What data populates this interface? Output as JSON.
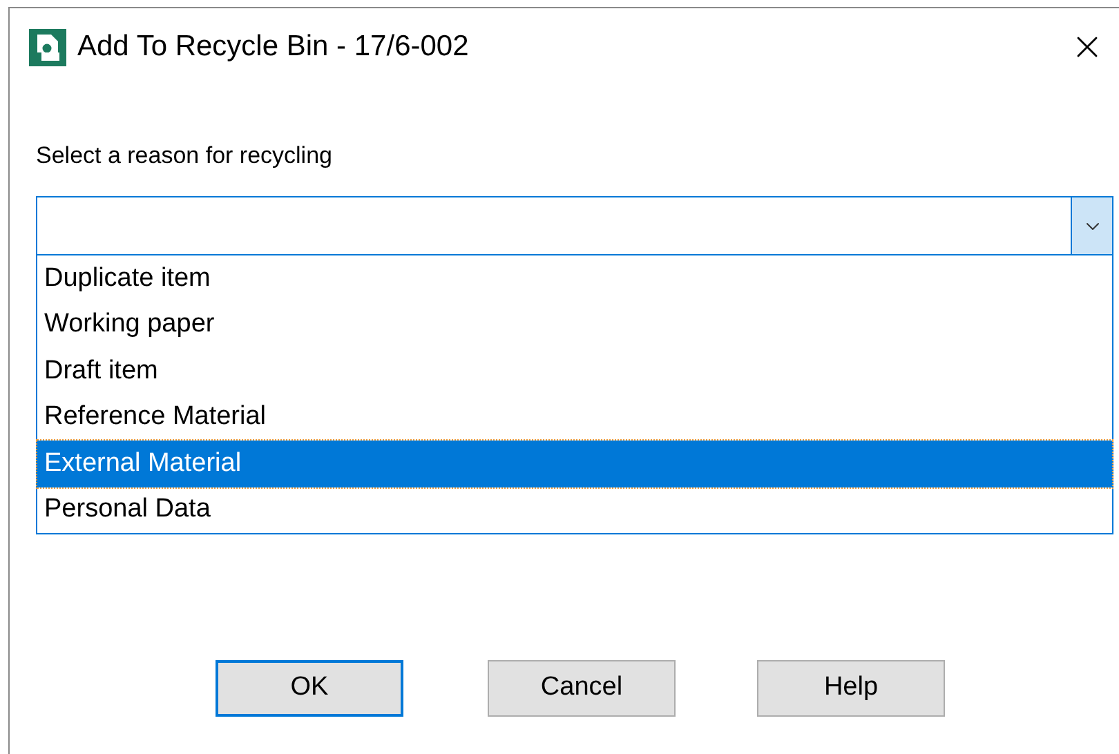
{
  "window": {
    "title": "Add To Recycle Bin - 17/6-002"
  },
  "reason": {
    "label": "Select a reason for recycling",
    "expanded": true,
    "options": [
      {
        "label": "Duplicate item",
        "selected": false
      },
      {
        "label": "Working paper",
        "selected": false
      },
      {
        "label": "Draft item",
        "selected": false
      },
      {
        "label": "Reference Material",
        "selected": false
      },
      {
        "label": "External Material",
        "selected": true
      },
      {
        "label": "Personal Data",
        "selected": false
      }
    ]
  },
  "buttons": [
    {
      "label": "OK",
      "default": true
    },
    {
      "label": "Cancel",
      "default": false
    },
    {
      "label": "Help",
      "default": false
    }
  ]
}
